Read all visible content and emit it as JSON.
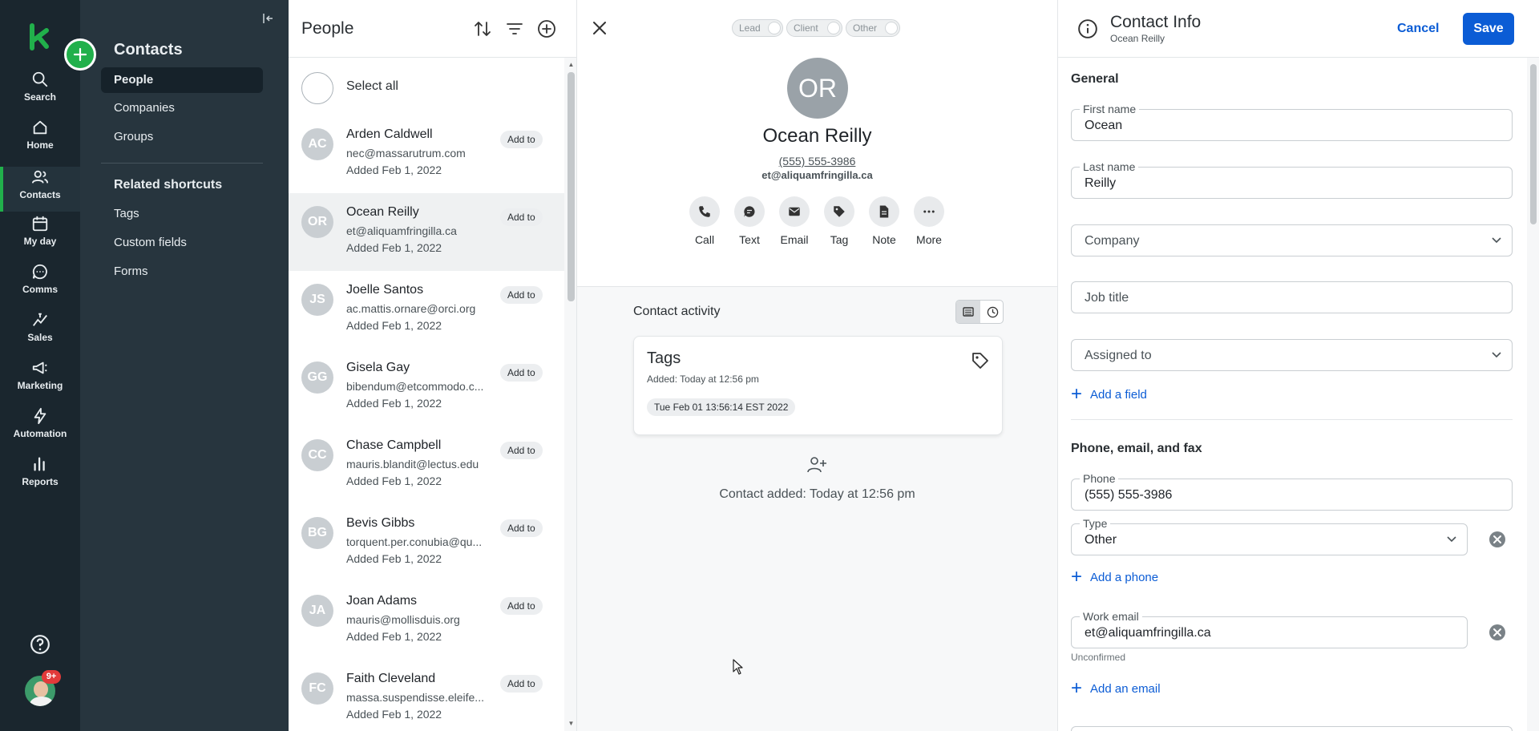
{
  "rail": {
    "items": [
      {
        "label": "Search",
        "icon": "search-icon"
      },
      {
        "label": "Home",
        "icon": "home-icon"
      },
      {
        "label": "Contacts",
        "icon": "contacts-icon",
        "active": true
      },
      {
        "label": "My day",
        "icon": "calendar-icon"
      },
      {
        "label": "Comms",
        "icon": "chat-icon"
      },
      {
        "label": "Sales",
        "icon": "sales-icon"
      },
      {
        "label": "Marketing",
        "icon": "megaphone-icon"
      },
      {
        "label": "Automation",
        "icon": "bolt-icon"
      },
      {
        "label": "Reports",
        "icon": "bar-chart-icon"
      }
    ],
    "notification_badge": "9+",
    "accent_color": "#21b04b"
  },
  "subnav": {
    "title": "Contacts",
    "items": [
      {
        "label": "People",
        "active": true
      },
      {
        "label": "Companies"
      },
      {
        "label": "Groups"
      }
    ],
    "shortcuts_heading": "Related shortcuts",
    "shortcuts": [
      {
        "label": "Tags"
      },
      {
        "label": "Custom fields"
      },
      {
        "label": "Forms"
      }
    ]
  },
  "people_list": {
    "title": "People",
    "select_all": "Select all",
    "add_to_label": "Add to",
    "rows": [
      {
        "initials": "AC",
        "name": "Arden Caldwell",
        "email": "nec@massarutrum.com",
        "added": "Added Feb 1, 2022"
      },
      {
        "initials": "OR",
        "name": "Ocean Reilly",
        "email": "et@aliquamfringilla.ca",
        "added": "Added Feb 1, 2022",
        "selected": true
      },
      {
        "initials": "JS",
        "name": "Joelle Santos",
        "email": "ac.mattis.ornare@orci.org",
        "added": "Added Feb 1, 2022"
      },
      {
        "initials": "GG",
        "name": "Gisela Gay",
        "email": "bibendum@etcommodo.c...",
        "added": "Added Feb 1, 2022"
      },
      {
        "initials": "CC",
        "name": "Chase Campbell",
        "email": "mauris.blandit@lectus.edu",
        "added": "Added Feb 1, 2022"
      },
      {
        "initials": "BG",
        "name": "Bevis Gibbs",
        "email": "torquent.per.conubia@qu...",
        "added": "Added Feb 1, 2022"
      },
      {
        "initials": "JA",
        "name": "Joan Adams",
        "email": "mauris@mollisduis.org",
        "added": "Added Feb 1, 2022"
      },
      {
        "initials": "FC",
        "name": "Faith Cleveland",
        "email": "massa.suspendisse.eleife...",
        "added": "Added Feb 1, 2022"
      }
    ]
  },
  "detail": {
    "status_toggles": [
      "Lead",
      "Client",
      "Other"
    ],
    "initials": "OR",
    "name": "Ocean Reilly",
    "phone": "(555) 555-3986",
    "email": "et@aliquamfringilla.ca",
    "actions": [
      {
        "label": "Call",
        "icon": "phone-icon"
      },
      {
        "label": "Text",
        "icon": "message-icon"
      },
      {
        "label": "Email",
        "icon": "envelope-icon"
      },
      {
        "label": "Tag",
        "icon": "tag-icon"
      },
      {
        "label": "Note",
        "icon": "note-icon"
      },
      {
        "label": "More",
        "icon": "more-icon"
      }
    ],
    "activity": {
      "title": "Contact activity",
      "tags_card": {
        "title": "Tags",
        "added_prefix": "Added:",
        "added_time": "Today at 12:56 pm",
        "chip": "Tue Feb 01 13:56:14 EST 2022"
      },
      "contact_added": "Contact added: Today at 12:56 pm"
    }
  },
  "edit_panel": {
    "title": "Contact Info",
    "subtitle": "Ocean Reilly",
    "cancel": "Cancel",
    "save": "Save",
    "general": {
      "heading": "General",
      "first_name_label": "First name",
      "first_name": "Ocean",
      "last_name_label": "Last name",
      "last_name": "Reilly",
      "company_placeholder": "Company",
      "job_title_placeholder": "Job title",
      "assigned_placeholder": "Assigned to",
      "add_field": "Add a field"
    },
    "contact_methods": {
      "heading": "Phone, email, and fax",
      "phone_label": "Phone",
      "phone": "(555) 555-3986",
      "type_label": "Type",
      "type": "Other",
      "add_phone": "Add a phone",
      "work_email_label": "Work email",
      "work_email": "et@aliquamfringilla.ca",
      "email_status": "Unconfirmed",
      "add_email": "Add an email"
    }
  }
}
